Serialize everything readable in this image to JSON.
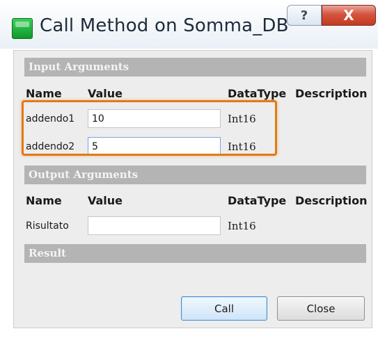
{
  "window": {
    "title": "Call Method on Somma_DB",
    "help_glyph": "?",
    "close_glyph": "X"
  },
  "input_arguments": {
    "header": "Input Arguments",
    "columns": {
      "name": "Name",
      "value": "Value",
      "datatype": "DataType",
      "description": "Description"
    },
    "rows": [
      {
        "name": "addendo1",
        "value": "10",
        "datatype": "Int16",
        "description": ""
      },
      {
        "name": "addendo2",
        "value": "5",
        "datatype": "Int16",
        "description": ""
      }
    ]
  },
  "output_arguments": {
    "header": "Output Arguments",
    "columns": {
      "name": "Name",
      "value": "Value",
      "datatype": "DataType",
      "description": "Description"
    },
    "rows": [
      {
        "name": "Risultato",
        "value": "",
        "datatype": "Int16",
        "description": ""
      }
    ]
  },
  "result": {
    "header": "Result"
  },
  "buttons": {
    "call": "Call",
    "close": "Close"
  },
  "colors": {
    "highlight": "#e07b12",
    "section_header_bg": "#b4b4b4",
    "close_button_red": "#c43a22"
  }
}
